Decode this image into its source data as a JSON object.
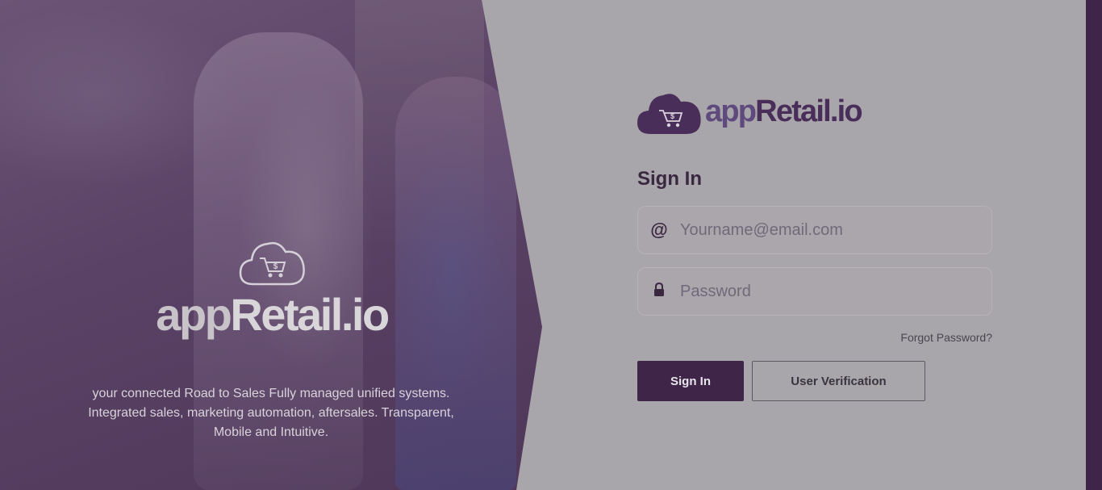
{
  "brand": {
    "prefix": "app",
    "main": "Retail.io",
    "cart_symbol": "$"
  },
  "tagline": "your connected Road to Sales Fully managed unified systems. Integrated sales, marketing automation, aftersales. Transparent, Mobile and Intuitive.",
  "signin": {
    "title": "Sign In",
    "email": {
      "icon": "at-icon",
      "icon_glyph": "@",
      "placeholder": "Yourname@email.com",
      "value": ""
    },
    "password": {
      "icon": "lock-icon",
      "placeholder": "Password",
      "value": ""
    },
    "forgot_label": "Forgot Password?",
    "submit_label": "Sign In",
    "verify_label": "User Verification"
  },
  "colors": {
    "brand_dark": "#3f2548",
    "brand_light": "#5f4a7d",
    "overlay": "#a9a6ab"
  }
}
